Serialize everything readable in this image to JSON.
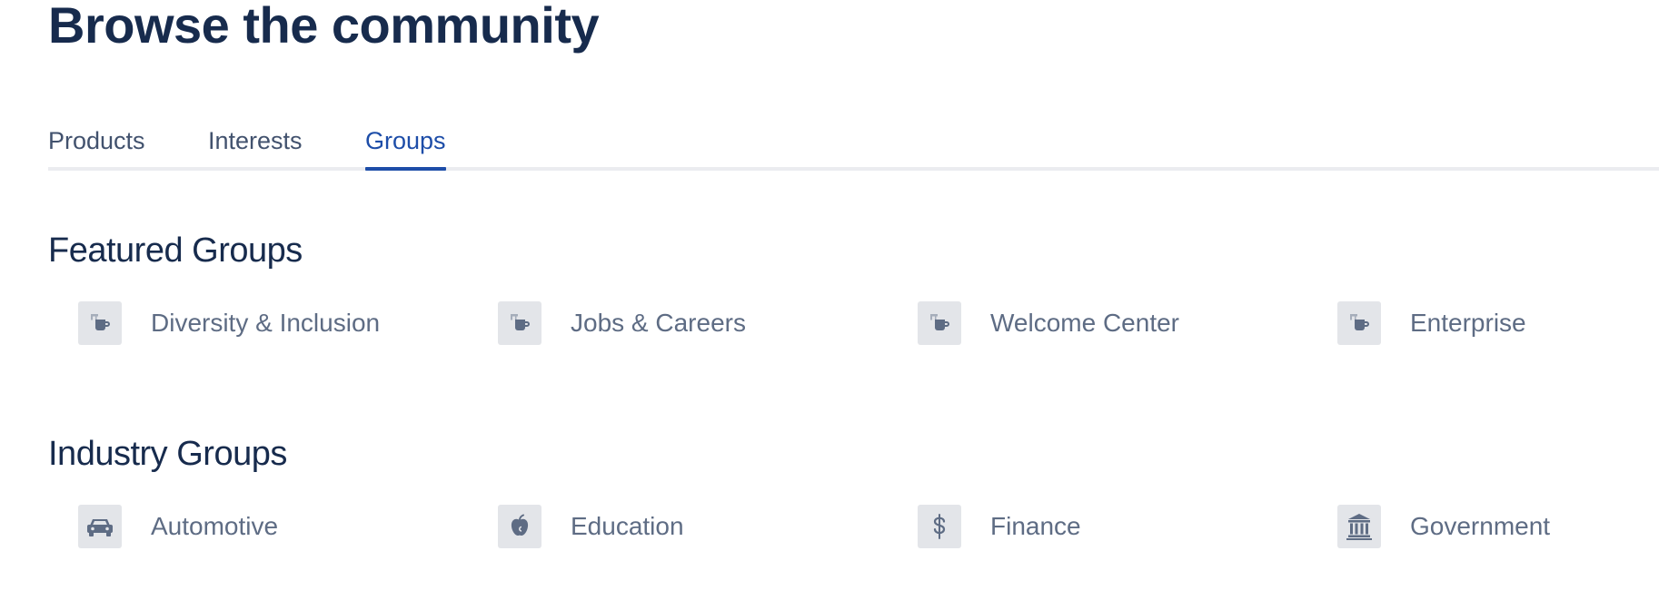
{
  "page": {
    "title": "Browse the community"
  },
  "tabs": [
    {
      "label": "Products",
      "active": false
    },
    {
      "label": "Interests",
      "active": false
    },
    {
      "label": "Groups",
      "active": true
    }
  ],
  "sections": [
    {
      "title": "Featured Groups",
      "items": [
        {
          "label": "Diversity & Inclusion",
          "icon": "coffee-mug-icon"
        },
        {
          "label": "Jobs & Careers",
          "icon": "coffee-mug-icon"
        },
        {
          "label": "Welcome Center",
          "icon": "coffee-mug-icon"
        },
        {
          "label": "Enterprise",
          "icon": "coffee-mug-icon"
        }
      ]
    },
    {
      "title": "Industry Groups",
      "items": [
        {
          "label": "Automotive",
          "icon": "car-icon"
        },
        {
          "label": "Education",
          "icon": "apple-icon"
        },
        {
          "label": "Finance",
          "icon": "dollar-icon"
        },
        {
          "label": "Government",
          "icon": "government-building-icon"
        }
      ]
    }
  ],
  "colors": {
    "heading": "#172B4D",
    "tab_text": "#42526E",
    "tab_active": "#1D4DA8",
    "item_text": "#5E6C84",
    "icon_bg": "#E3E5E9",
    "icon_fg": "#5E6C84",
    "divider": "#EBECF0"
  }
}
